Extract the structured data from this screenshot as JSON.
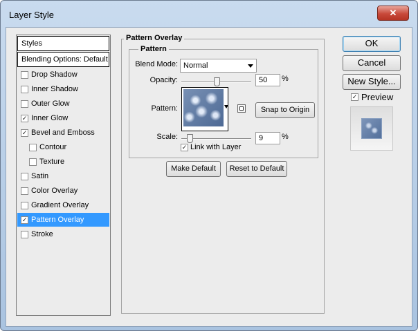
{
  "window": {
    "title": "Layer Style",
    "close_glyph": "✕"
  },
  "sidebar": {
    "header": "Styles",
    "blending_options": "Blending Options: Default",
    "items": [
      {
        "label": "Drop Shadow",
        "checked": false,
        "indent": false,
        "selected": false
      },
      {
        "label": "Inner Shadow",
        "checked": false,
        "indent": false,
        "selected": false
      },
      {
        "label": "Outer Glow",
        "checked": false,
        "indent": false,
        "selected": false
      },
      {
        "label": "Inner Glow",
        "checked": true,
        "indent": false,
        "selected": false
      },
      {
        "label": "Bevel and Emboss",
        "checked": true,
        "indent": false,
        "selected": false
      },
      {
        "label": "Contour",
        "checked": false,
        "indent": true,
        "selected": false
      },
      {
        "label": "Texture",
        "checked": false,
        "indent": true,
        "selected": false
      },
      {
        "label": "Satin",
        "checked": false,
        "indent": false,
        "selected": false
      },
      {
        "label": "Color Overlay",
        "checked": false,
        "indent": false,
        "selected": false
      },
      {
        "label": "Gradient Overlay",
        "checked": false,
        "indent": false,
        "selected": false
      },
      {
        "label": "Pattern Overlay",
        "checked": true,
        "indent": false,
        "selected": true
      },
      {
        "label": "Stroke",
        "checked": false,
        "indent": false,
        "selected": false
      }
    ]
  },
  "panel": {
    "section_title": "Pattern Overlay",
    "group_title": "Pattern",
    "blend_mode": {
      "label": "Blend Mode:",
      "value": "Normal"
    },
    "opacity": {
      "label": "Opacity:",
      "value": "50",
      "unit": "%",
      "slider_percent": 50
    },
    "pattern": {
      "label": "Pattern:",
      "snap_button": "Snap to Origin"
    },
    "scale": {
      "label": "Scale:",
      "value": "9",
      "unit": "%",
      "slider_percent": 9
    },
    "link_with_layer": {
      "label": "Link with Layer",
      "checked": true
    },
    "make_default": "Make Default",
    "reset_to_default": "Reset to Default"
  },
  "actions": {
    "ok": "OK",
    "cancel": "Cancel",
    "new_style": "New Style...",
    "preview": {
      "label": "Preview",
      "checked": true
    }
  },
  "colors": {
    "selection": "#3399ff",
    "dialog_bg": "#ececec",
    "title_bar": "#b9cfe8",
    "close_button": "#c8493a"
  },
  "icons": {
    "checkmark": "✓",
    "dropdown": "chevron-down-icon",
    "new_preset": "new-preset-icon"
  }
}
